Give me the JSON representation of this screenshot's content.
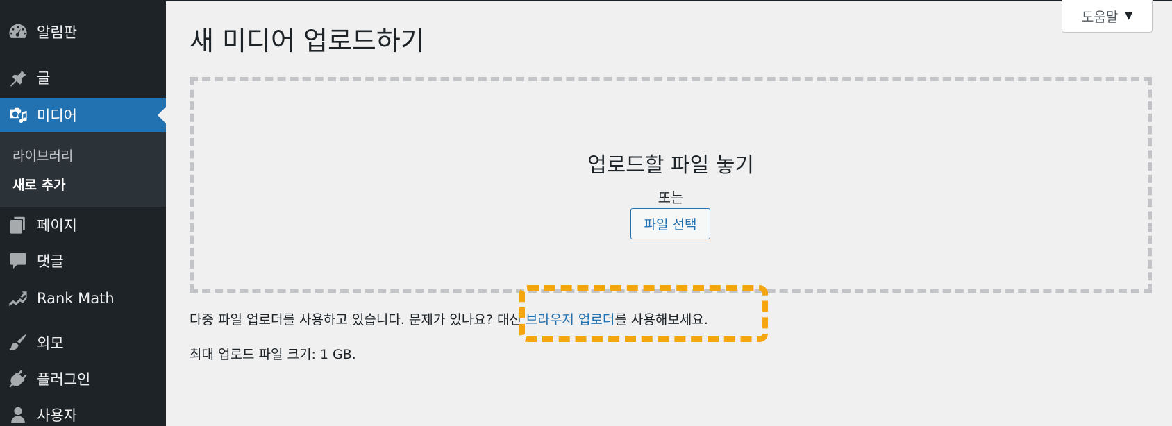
{
  "sidebar": {
    "items": [
      {
        "label": "알림판",
        "icon": "dashboard-icon"
      },
      {
        "label": "글",
        "icon": "pin-icon"
      },
      {
        "label": "미디어",
        "icon": "media-icon"
      },
      {
        "label": "페이지",
        "icon": "pages-icon"
      },
      {
        "label": "댓글",
        "icon": "comment-icon"
      },
      {
        "label": "Rank Math",
        "icon": "rankmath-icon"
      },
      {
        "label": "외모",
        "icon": "brush-icon"
      },
      {
        "label": "플러그인",
        "icon": "plugin-icon"
      },
      {
        "label": "사용자",
        "icon": "user-icon"
      }
    ],
    "submenu": [
      {
        "label": "라이브러리"
      },
      {
        "label": "새로 추가"
      }
    ]
  },
  "help": {
    "label": "도움말"
  },
  "page": {
    "title": "새 미디어 업로드하기"
  },
  "dropzone": {
    "title": "업로드할 파일 놓기",
    "or": "또는",
    "select_button": "파일 선택"
  },
  "info": {
    "prefix": "다중 파일 업로더를 사용하고 있습니다. 문제가 있나요? 대신 ",
    "link": "브라우저 업로더",
    "suffix": "를 사용해보세요.",
    "max_size": "최대 업로드 파일 크기: 1 GB."
  },
  "colors": {
    "sidebar_bg": "#1d2327",
    "accent": "#2271b1",
    "highlight": "#f5a60f"
  }
}
